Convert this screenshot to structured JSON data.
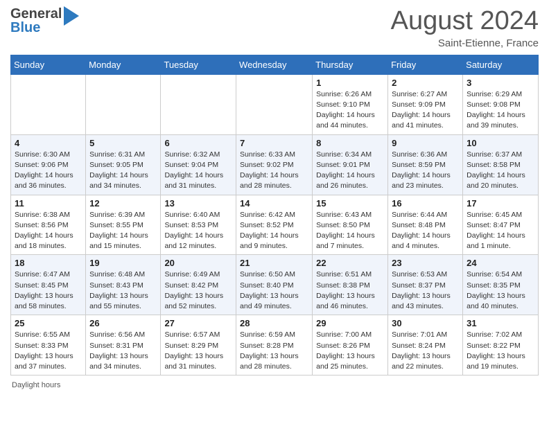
{
  "header": {
    "logo_line1": "General",
    "logo_line2": "Blue",
    "month_title": "August 2024",
    "location": "Saint-Etienne, France"
  },
  "weekdays": [
    "Sunday",
    "Monday",
    "Tuesday",
    "Wednesday",
    "Thursday",
    "Friday",
    "Saturday"
  ],
  "footer": "Daylight hours",
  "weeks": [
    [
      {
        "day": "",
        "info": ""
      },
      {
        "day": "",
        "info": ""
      },
      {
        "day": "",
        "info": ""
      },
      {
        "day": "",
        "info": ""
      },
      {
        "day": "1",
        "info": "Sunrise: 6:26 AM\nSunset: 9:10 PM\nDaylight: 14 hours\nand 44 minutes."
      },
      {
        "day": "2",
        "info": "Sunrise: 6:27 AM\nSunset: 9:09 PM\nDaylight: 14 hours\nand 41 minutes."
      },
      {
        "day": "3",
        "info": "Sunrise: 6:29 AM\nSunset: 9:08 PM\nDaylight: 14 hours\nand 39 minutes."
      }
    ],
    [
      {
        "day": "4",
        "info": "Sunrise: 6:30 AM\nSunset: 9:06 PM\nDaylight: 14 hours\nand 36 minutes."
      },
      {
        "day": "5",
        "info": "Sunrise: 6:31 AM\nSunset: 9:05 PM\nDaylight: 14 hours\nand 34 minutes."
      },
      {
        "day": "6",
        "info": "Sunrise: 6:32 AM\nSunset: 9:04 PM\nDaylight: 14 hours\nand 31 minutes."
      },
      {
        "day": "7",
        "info": "Sunrise: 6:33 AM\nSunset: 9:02 PM\nDaylight: 14 hours\nand 28 minutes."
      },
      {
        "day": "8",
        "info": "Sunrise: 6:34 AM\nSunset: 9:01 PM\nDaylight: 14 hours\nand 26 minutes."
      },
      {
        "day": "9",
        "info": "Sunrise: 6:36 AM\nSunset: 8:59 PM\nDaylight: 14 hours\nand 23 minutes."
      },
      {
        "day": "10",
        "info": "Sunrise: 6:37 AM\nSunset: 8:58 PM\nDaylight: 14 hours\nand 20 minutes."
      }
    ],
    [
      {
        "day": "11",
        "info": "Sunrise: 6:38 AM\nSunset: 8:56 PM\nDaylight: 14 hours\nand 18 minutes."
      },
      {
        "day": "12",
        "info": "Sunrise: 6:39 AM\nSunset: 8:55 PM\nDaylight: 14 hours\nand 15 minutes."
      },
      {
        "day": "13",
        "info": "Sunrise: 6:40 AM\nSunset: 8:53 PM\nDaylight: 14 hours\nand 12 minutes."
      },
      {
        "day": "14",
        "info": "Sunrise: 6:42 AM\nSunset: 8:52 PM\nDaylight: 14 hours\nand 9 minutes."
      },
      {
        "day": "15",
        "info": "Sunrise: 6:43 AM\nSunset: 8:50 PM\nDaylight: 14 hours\nand 7 minutes."
      },
      {
        "day": "16",
        "info": "Sunrise: 6:44 AM\nSunset: 8:48 PM\nDaylight: 14 hours\nand 4 minutes."
      },
      {
        "day": "17",
        "info": "Sunrise: 6:45 AM\nSunset: 8:47 PM\nDaylight: 14 hours\nand 1 minute."
      }
    ],
    [
      {
        "day": "18",
        "info": "Sunrise: 6:47 AM\nSunset: 8:45 PM\nDaylight: 13 hours\nand 58 minutes."
      },
      {
        "day": "19",
        "info": "Sunrise: 6:48 AM\nSunset: 8:43 PM\nDaylight: 13 hours\nand 55 minutes."
      },
      {
        "day": "20",
        "info": "Sunrise: 6:49 AM\nSunset: 8:42 PM\nDaylight: 13 hours\nand 52 minutes."
      },
      {
        "day": "21",
        "info": "Sunrise: 6:50 AM\nSunset: 8:40 PM\nDaylight: 13 hours\nand 49 minutes."
      },
      {
        "day": "22",
        "info": "Sunrise: 6:51 AM\nSunset: 8:38 PM\nDaylight: 13 hours\nand 46 minutes."
      },
      {
        "day": "23",
        "info": "Sunrise: 6:53 AM\nSunset: 8:37 PM\nDaylight: 13 hours\nand 43 minutes."
      },
      {
        "day": "24",
        "info": "Sunrise: 6:54 AM\nSunset: 8:35 PM\nDaylight: 13 hours\nand 40 minutes."
      }
    ],
    [
      {
        "day": "25",
        "info": "Sunrise: 6:55 AM\nSunset: 8:33 PM\nDaylight: 13 hours\nand 37 minutes."
      },
      {
        "day": "26",
        "info": "Sunrise: 6:56 AM\nSunset: 8:31 PM\nDaylight: 13 hours\nand 34 minutes."
      },
      {
        "day": "27",
        "info": "Sunrise: 6:57 AM\nSunset: 8:29 PM\nDaylight: 13 hours\nand 31 minutes."
      },
      {
        "day": "28",
        "info": "Sunrise: 6:59 AM\nSunset: 8:28 PM\nDaylight: 13 hours\nand 28 minutes."
      },
      {
        "day": "29",
        "info": "Sunrise: 7:00 AM\nSunset: 8:26 PM\nDaylight: 13 hours\nand 25 minutes."
      },
      {
        "day": "30",
        "info": "Sunrise: 7:01 AM\nSunset: 8:24 PM\nDaylight: 13 hours\nand 22 minutes."
      },
      {
        "day": "31",
        "info": "Sunrise: 7:02 AM\nSunset: 8:22 PM\nDaylight: 13 hours\nand 19 minutes."
      }
    ]
  ]
}
